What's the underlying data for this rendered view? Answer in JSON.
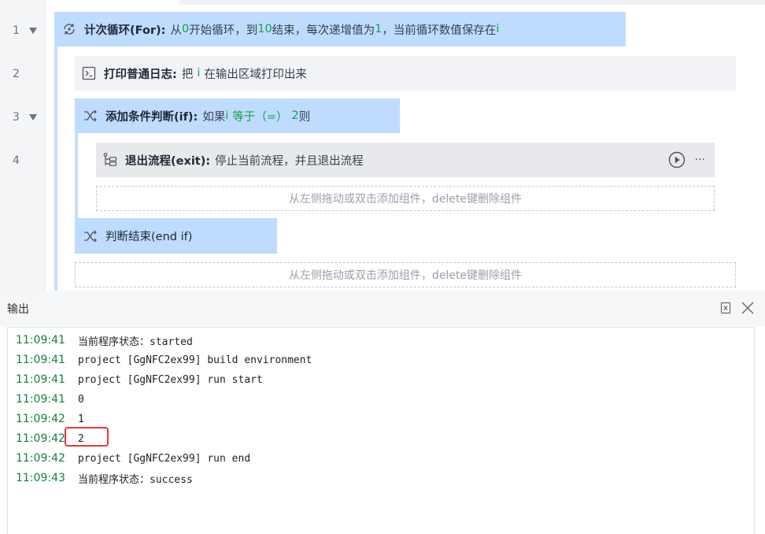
{
  "editor": {
    "line_numbers": [
      "1",
      "2",
      "3",
      "4"
    ],
    "blocks": {
      "for": {
        "title": "计次循环(For):",
        "p1": "从",
        "start": "0",
        "p2": "开始循环，到",
        "end": "10",
        "p3": "结束，每次递增值为",
        "step": "1",
        "p4": "，当前循环数值保存在",
        "var": "i",
        "icon": "loop-icon"
      },
      "log": {
        "title": "打印普通日志:",
        "p1": "把",
        "var": "i",
        "p2": "在输出区域打印出来",
        "icon": "terminal-icon"
      },
      "if": {
        "title": "添加条件判断(if):",
        "p1": "如果",
        "var": "i",
        "op": "等于（=）",
        "value": "2",
        "p2": "则",
        "icon": "branch-icon"
      },
      "exit": {
        "title": "退出流程(exit):",
        "desc": "停止当前流程，并且退出流程",
        "icon": "flow-exit-icon",
        "more": "···"
      },
      "endif": {
        "title": "判断结束(end if)",
        "icon": "branch-icon"
      }
    },
    "drop_hint": "从左侧拖动或双击添加组件，delete键删除组件"
  },
  "output": {
    "title": "输出",
    "lines": [
      {
        "time": "11:09:41",
        "text": "当前程序状态：started"
      },
      {
        "time": "11:09:41",
        "text": "project [GgNFC2ex99] build environment"
      },
      {
        "time": "11:09:41",
        "text": "project [GgNFC2ex99] run start"
      },
      {
        "time": "11:09:41",
        "text": "0"
      },
      {
        "time": "11:09:42",
        "text": "1"
      },
      {
        "time": "11:09:42",
        "text": "2"
      },
      {
        "time": "11:09:42",
        "text": "project [GgNFC2ex99] run end"
      },
      {
        "time": "11:09:43",
        "text": "当前程序状态：success"
      }
    ]
  },
  "colors": {
    "block_blue": "#bfdbfe",
    "value_green": "#16a34a",
    "timestamp_green": "#15803d",
    "highlight_red": "#e53935"
  }
}
